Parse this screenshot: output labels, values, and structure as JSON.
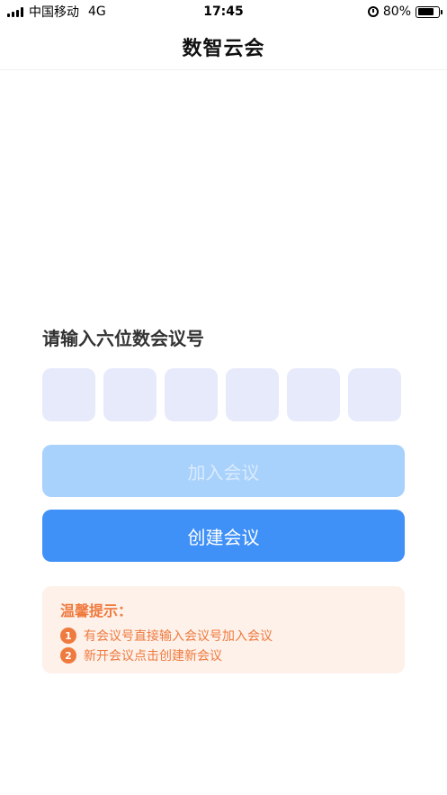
{
  "status_bar": {
    "carrier": "中国移动",
    "network": "4G",
    "time": "17:45",
    "battery": "80%",
    "battery_level": 0.8
  },
  "header": {
    "title": "数智云会"
  },
  "main": {
    "prompt": "请输入六位数会议号",
    "code_boxes": [
      "",
      "",
      "",
      "",
      "",
      ""
    ],
    "join_button": "加入会议",
    "create_button": "创建会议"
  },
  "tips": {
    "title": "温馨提示：",
    "items": [
      {
        "num": "1",
        "text": "有会议号直接输入会议号加入会议"
      },
      {
        "num": "2",
        "text": "新开会议点击创建新会议"
      }
    ]
  },
  "colors": {
    "accent": "#3f90f7",
    "accent_disabled": "#a8d1fb",
    "code_box": "#e6eafb",
    "tip_bg": "#fdf1ea",
    "tip_text": "#ef7a3e"
  }
}
